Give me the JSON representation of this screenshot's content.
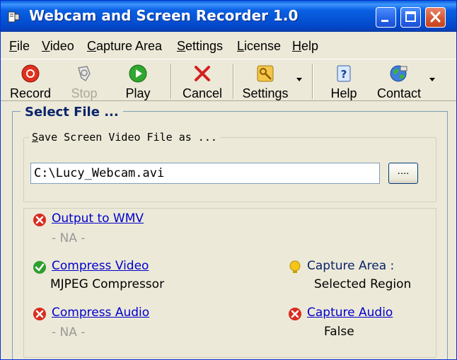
{
  "window": {
    "title": "Webcam and Screen Recorder 1.0"
  },
  "menu": [
    {
      "label": "File",
      "mnemonic": "F",
      "rest": "ile"
    },
    {
      "label": "Video",
      "mnemonic": "V",
      "rest": "ideo"
    },
    {
      "label": "Capture Area",
      "mnemonic": "C",
      "rest": "apture Area"
    },
    {
      "label": "Settings",
      "mnemonic": "S",
      "rest": "ettings"
    },
    {
      "label": "License",
      "mnemonic": "L",
      "rest": "icense"
    },
    {
      "label": "Help",
      "mnemonic": "H",
      "rest": "elp"
    }
  ],
  "toolbar": {
    "record": "Record",
    "stop": "Stop",
    "play": "Play",
    "cancel": "Cancel",
    "settings": "Settings",
    "help": "Help",
    "contact": "Contact"
  },
  "main": {
    "section_title": "Select File ...",
    "save_group": {
      "legend_mnemonic": "S",
      "legend_rest": "ave Screen Video File as ...",
      "path_value": "C:\\Lucy_Webcam.avi",
      "browse_label": "...."
    },
    "options": {
      "output_wmv": {
        "label": "Output to WMV",
        "value": "- NA -",
        "status": "disabled"
      },
      "compress_video": {
        "label": "Compress Video",
        "value": "MJPEG Compressor",
        "status": "enabled"
      },
      "compress_audio": {
        "label": "Compress Audio",
        "value": "- NA -",
        "status": "disabled"
      },
      "capture_area": {
        "label": "Capture Area :",
        "value": "Selected Region"
      },
      "capture_audio": {
        "label": "Capture Audio",
        "value": "False",
        "status": "disabled"
      }
    }
  },
  "colors": {
    "title_bar": "#0453d5",
    "window_bg": "#ece9d8",
    "link": "#0000cc",
    "error_red": "#d92b1f",
    "ok_green": "#2e9e2e"
  }
}
